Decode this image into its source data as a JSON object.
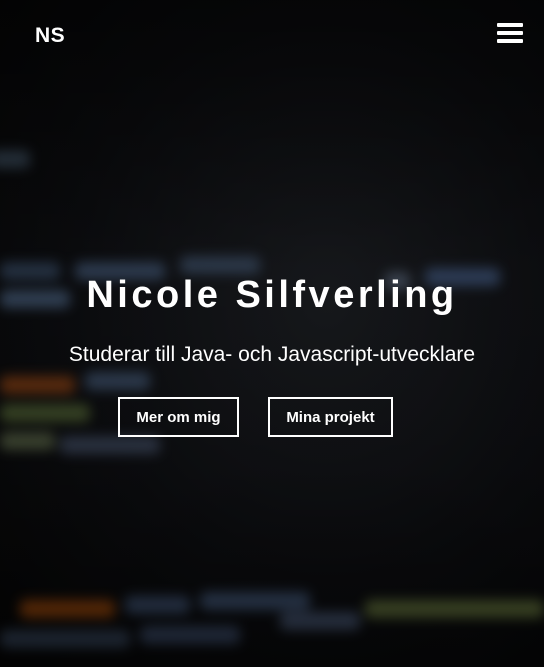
{
  "header": {
    "logo": "NS",
    "menu_icon": "hamburger-menu-icon"
  },
  "hero": {
    "title": "Nicole Silfverling",
    "subtitle": "Studerar till Java- och Javascript-utvecklare",
    "buttons": [
      {
        "label": "Mer om mig"
      },
      {
        "label": "Mina projekt"
      }
    ]
  }
}
